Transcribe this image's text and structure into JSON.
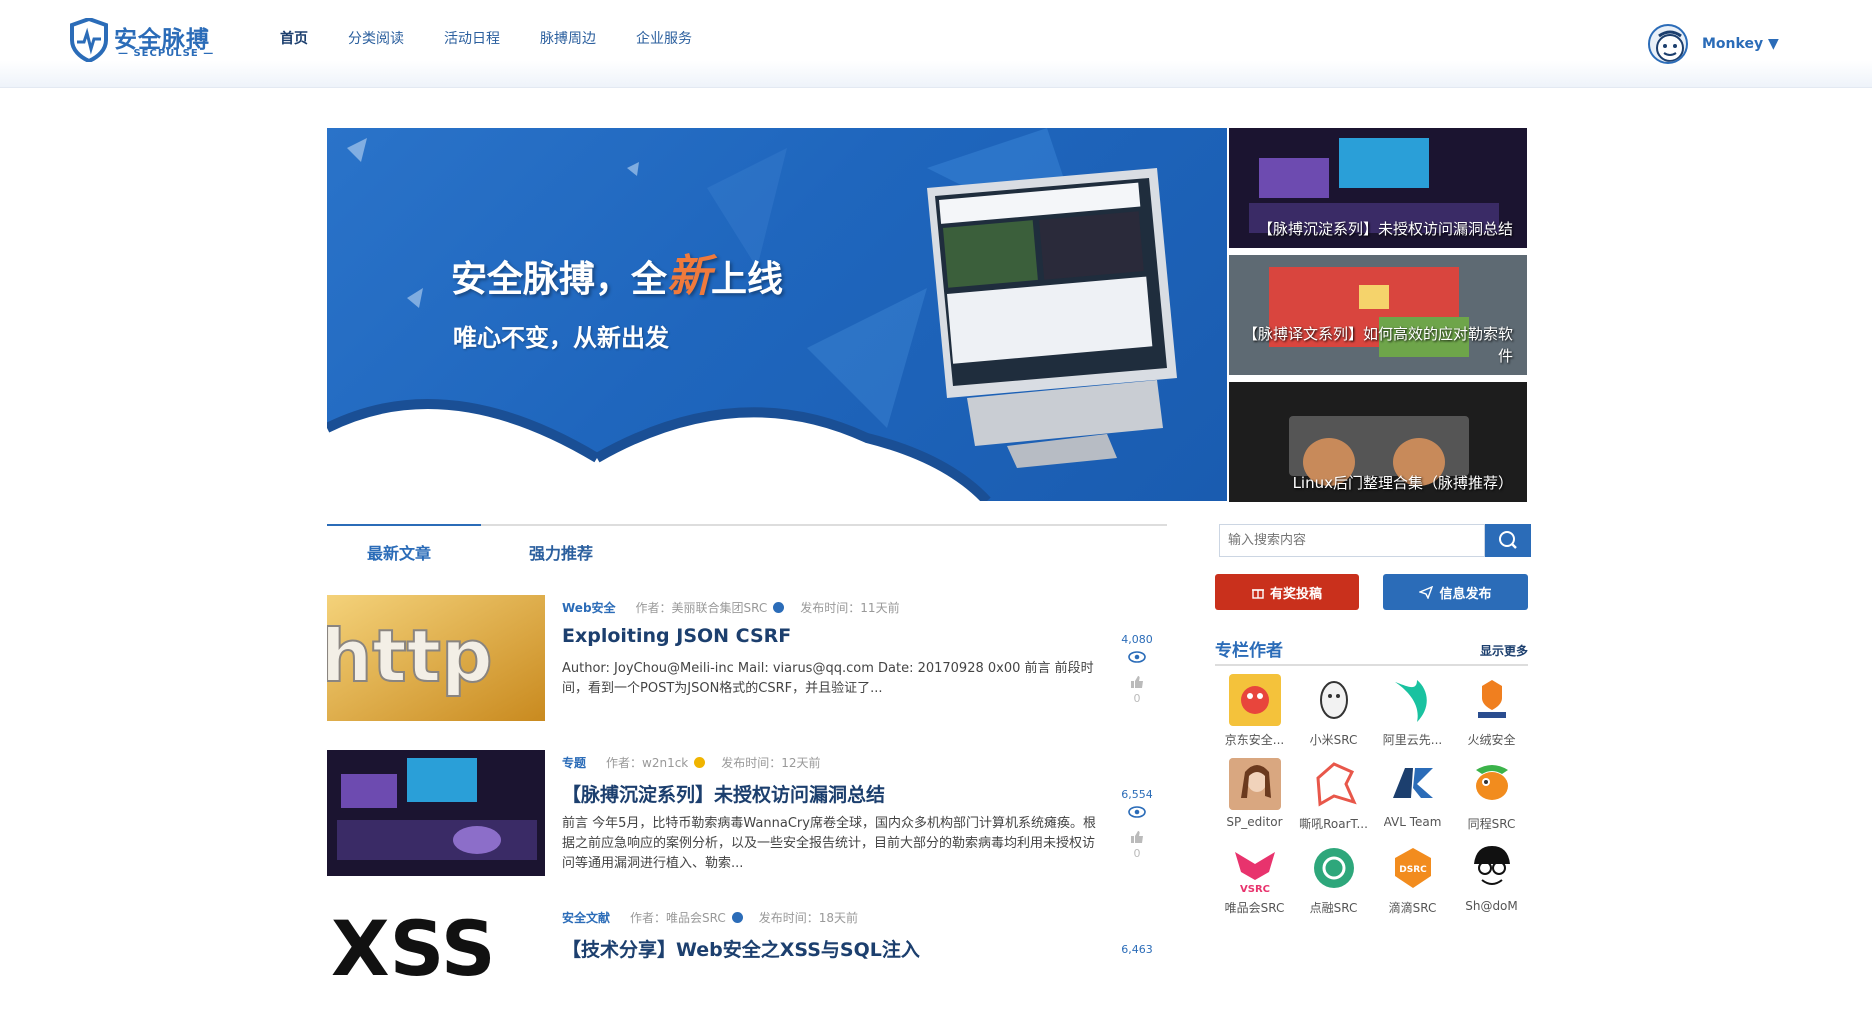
{
  "header": {
    "brand": "安全脉搏",
    "brand_sub": "— SECPULSE —",
    "nav": [
      "首页",
      "分类阅读",
      "活动日程",
      "脉搏周边",
      "企业服务"
    ],
    "user": "Monkey ▼"
  },
  "banner": {
    "title_pre": "安全脉搏，全",
    "title_hl": "新",
    "title_post": "上线",
    "slogan": "唯心不变，从新出发"
  },
  "side_slides": [
    "【脉搏沉淀系列】未授权访问漏洞总结",
    "【脉搏译文系列】如何高效的应对勒索软件",
    "Linux后门整理合集（脉搏推荐）"
  ],
  "tabs": [
    "最新文章",
    "强力推荐"
  ],
  "articles": [
    {
      "category": "Web安全",
      "author": "作者：美丽联合集团SRC",
      "time": "发布时间：11天前",
      "title": "Exploiting JSON CSRF",
      "summary": "Author: JoyChou@Meili-inc Mail: viarus@qq.com Date: 20170928 0x00 前言 前段时间，看到一个POST为JSON格式的CSRF，并且验证了...",
      "views": "4,080",
      "likes": "0"
    },
    {
      "category": "专题",
      "author": "作者：w2n1ck",
      "time": "发布时间：12天前",
      "title": "【脉搏沉淀系列】未授权访问漏洞总结",
      "summary": " 前言 今年5月，比特币勒索病毒WannaCry席卷全球，国内众多机构部门计算机系统瘫痪。根据之前应急响应的案例分析，以及一些安全报告统计，目前大部分的勒索病毒均利用未授权访问等通用漏洞进行植入、勒索...",
      "views": "6,554",
      "likes": "0"
    },
    {
      "category": "安全文献",
      "author": "作者：唯品会SRC",
      "time": "发布时间：18天前",
      "title": "【技术分享】Web安全之XSS与SQL注入",
      "summary": "",
      "views": "6,463",
      "likes": ""
    }
  ],
  "search": {
    "placeholder": "输入搜索内容"
  },
  "buttons": {
    "submit": "有奖投稿",
    "publish": "信息发布"
  },
  "authors_section": {
    "title": "专栏作者",
    "more": "显示更多",
    "authors": [
      "京东安全...",
      "小米SRC",
      "阿里云先...",
      "火绒安全",
      "SP_editor",
      "嘶吼RoarT...",
      "AVL Team",
      "同程SRC",
      "唯品会SRC",
      "点融SRC",
      "滴滴SRC",
      "Sh@doM"
    ]
  },
  "colors": {
    "brand_blue": "#2b6cb8",
    "title_navy": "#1c3f6e",
    "submit_red": "#c9301c"
  }
}
